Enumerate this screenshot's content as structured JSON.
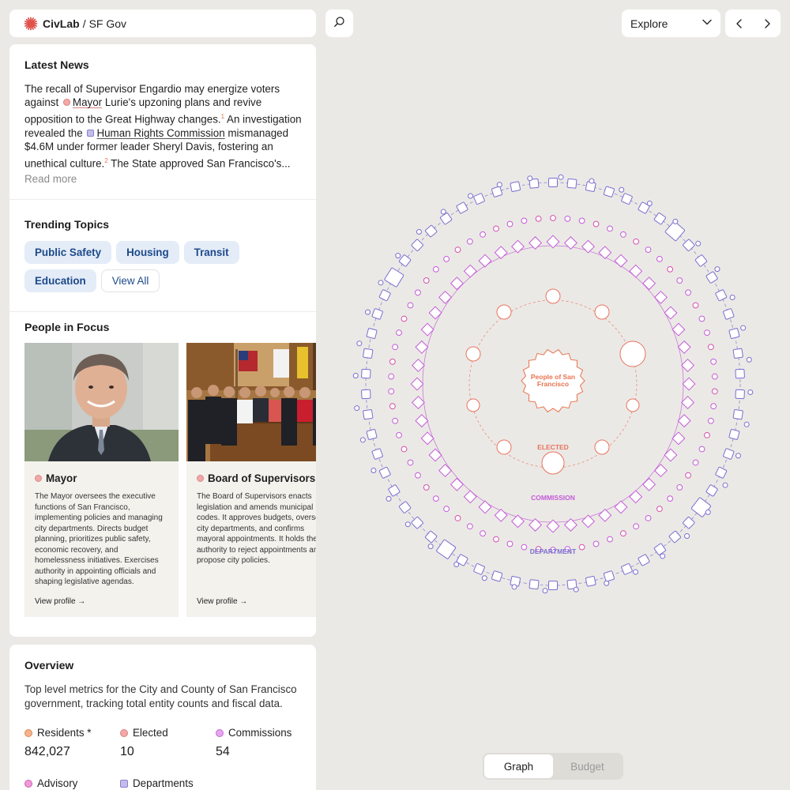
{
  "brand": {
    "name": "CivLab",
    "separator": "/",
    "context": "SF Gov"
  },
  "icons": {
    "brand": "burst-icon",
    "search": "search-icon",
    "chevron": "chevron-down-icon",
    "prev": "chevron-left-icon",
    "next": "chevron-right-icon"
  },
  "explore": {
    "selected": "Explore"
  },
  "news": {
    "title": "Latest News",
    "seg1": "The recall of Supervisor Engardio may energize voters against",
    "ent1": "Mayor",
    "seg2": " Lurie's upzoning plans and revive opposition to the Great Highway changes.",
    "ref1": "1",
    "seg3": " An investigation revealed the",
    "ent2": "Human Rights Commission",
    "seg4": " mismanaged $4.6M under former leader Sheryl Davis, fostering an unethical culture.",
    "ref2": "2",
    "seg5": " The State approved San Francisco's...",
    "read_more": "Read more"
  },
  "trending": {
    "title": "Trending Topics",
    "topics": [
      "Public Safety",
      "Housing",
      "Transit",
      "Education"
    ],
    "view_all": "View All"
  },
  "people": {
    "title": "People in Focus",
    "cards": [
      {
        "name": "Mayor",
        "description": "The Mayor oversees the executive functions of San Francisco, implementing policies and managing city departments. Directs budget planning, prioritizes public safety, economic recovery, and homelessness initiatives. Exercises authority in appointing officials and shaping legislative agendas.",
        "link": "View profile →"
      },
      {
        "name": "Board of Supervisors",
        "description": "The Board of Supervisors enacts legislation and amends municipal codes. It approves budgets, oversees city departments, and confirms mayoral appointments. It holds the authority to reject appointments and propose city policies.",
        "link": "View profile →"
      }
    ]
  },
  "overview": {
    "title": "Overview",
    "description": "Top level metrics for the City and County of San Francisco government, tracking total entity counts and fiscal data.",
    "metrics": [
      {
        "label": "Residents *",
        "value": "842,027",
        "color": "#f4b48c",
        "border": "#e08a55",
        "shape": "circle"
      },
      {
        "label": "Elected",
        "value": "10",
        "color": "#f4a8a8",
        "border": "#d98080",
        "shape": "circle"
      },
      {
        "label": "Commissions",
        "value": "54",
        "color": "#e6a6ee",
        "border": "#c76ad6",
        "shape": "circle"
      },
      {
        "label": "Advisory",
        "value": "",
        "color": "#ee9ad8",
        "border": "#d45fb6",
        "shape": "circle"
      },
      {
        "label": "Departments",
        "value": "",
        "color": "#c2bdea",
        "border": "#8a80cf",
        "shape": "square"
      }
    ]
  },
  "graph": {
    "center_label_line1": "People of San",
    "center_label_line2": "Francisco",
    "ring_labels": {
      "elected": "ELECTED",
      "commission": "COMMISSION",
      "department": "DEPARTMENT"
    },
    "colors": {
      "center": "#e8734f",
      "elected": "#e8735f",
      "commission": "#c35bd8",
      "department": "#7a6fd0",
      "advisory": "#d44fb0"
    }
  },
  "tabs": {
    "graph": "Graph",
    "budget": "Budget"
  }
}
